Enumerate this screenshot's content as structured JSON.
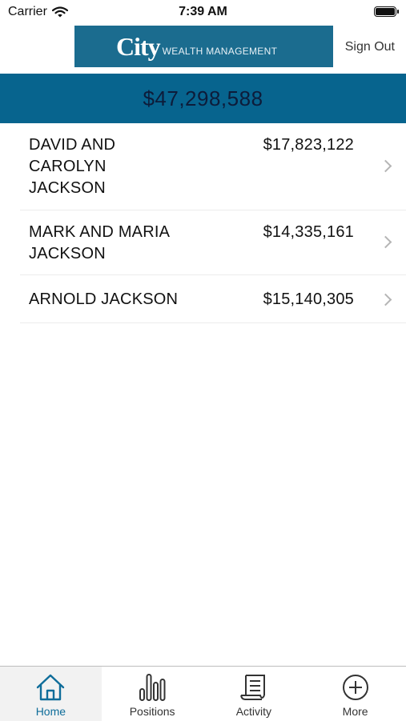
{
  "status_bar": {
    "carrier": "Carrier",
    "time": "7:39 AM"
  },
  "header": {
    "logo_main": "City",
    "logo_sub": "WEALTH MANAGEMENT",
    "sign_out_label": "Sign Out",
    "logo_color": "#1b6c8f"
  },
  "total": {
    "value": "$47,298,588",
    "banner_color": "#07648e"
  },
  "accounts": [
    {
      "name_lines": [
        "DAVID AND",
        "CAROLYN",
        "JACKSON"
      ],
      "amount": "$17,823,122"
    },
    {
      "name_lines": [
        "MARK AND MARIA",
        "JACKSON"
      ],
      "amount": "$14,335,161"
    },
    {
      "name_lines": [
        "ARNOLD JACKSON"
      ],
      "amount": "$15,140,305"
    }
  ],
  "tabs": [
    {
      "label": "Home",
      "icon": "home-icon",
      "active": true
    },
    {
      "label": "Positions",
      "icon": "bar-chart-icon",
      "active": false
    },
    {
      "label": "Activity",
      "icon": "receipt-icon",
      "active": false
    },
    {
      "label": "More",
      "icon": "plus-circle-icon",
      "active": false
    }
  ]
}
